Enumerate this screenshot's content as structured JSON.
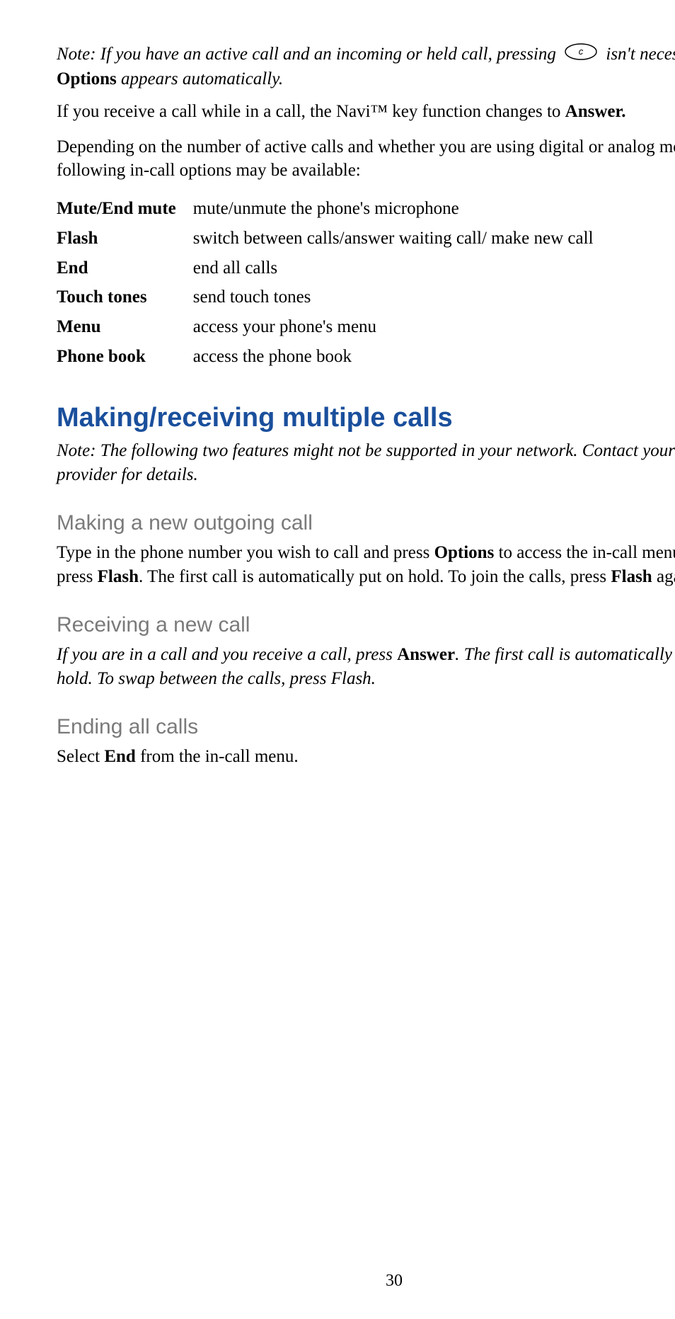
{
  "note1": {
    "pre": "Note:  If you have an active call and an incoming or held call, pressing ",
    "mid": " isn't necessary; ",
    "bold": "Options",
    "post": " appears automatically."
  },
  "para_navi": {
    "pre": "If you receive a call while in a call, the Navi™ key function changes to ",
    "bold": "Answer."
  },
  "para_depend": "Depending on the number of active calls and whether you are using digital or analog mode, the following in-call options may be available:",
  "options": [
    {
      "label": "Mute/End mute",
      "desc": "mute/unmute the phone's microphone"
    },
    {
      "label": "Flash",
      "desc": "switch between calls/answer waiting call/ make new call"
    },
    {
      "label": "End",
      "desc": "end all calls"
    },
    {
      "label": "Touch tones",
      "desc": "send touch tones"
    },
    {
      "label": "Menu",
      "desc": "access your phone's menu"
    },
    {
      "label": "Phone book",
      "desc": "access the phone book"
    }
  ],
  "section_title": "Making/receiving multiple calls",
  "note2": "Note:  The following two features might not be supported in your network. Contact your service provider for details.",
  "sub1": {
    "title": "Making a new outgoing call",
    "t1": "Type in the phone number you wish to call and press ",
    "b1": "Options",
    "t2": " to access the in-call menu. Then, press ",
    "b2": "Flash",
    "t3": ". The first call is automatically put on hold. To join the calls, press ",
    "b3": "Flash",
    "t4": " again."
  },
  "sub2": {
    "title": "Receiving a new call",
    "t1": "If you are in a call and you receive a call, press ",
    "b1": "Answer",
    "t2": ". The first call is automatically put on hold. To swap between the calls, press Flash."
  },
  "sub3": {
    "title": "Ending all calls",
    "t1": "Select ",
    "b1": "End",
    "t2": " from the in-call menu."
  },
  "page_number": "30"
}
